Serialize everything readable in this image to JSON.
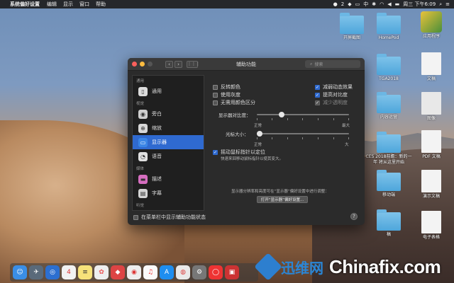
{
  "menubar": {
    "apple": "",
    "app": "系统偏好设置",
    "items": [
      "编辑",
      "显示",
      "窗口",
      "帮助"
    ],
    "status": {
      "badge": "2",
      "input": "中",
      "clock": "周三 下午6:09"
    }
  },
  "desktop": {
    "icons": [
      {
        "label": "开屏截图"
      },
      {
        "label": "HomePod"
      },
      {
        "label": "应用程序"
      },
      {
        "label": "TGA2018"
      },
      {
        "label": "文稿"
      },
      {
        "label": "内容运营"
      },
      {
        "label": "图像"
      },
      {
        "label": "CES 2018前瞻：新的一年 将从这里开始"
      },
      {
        "label": "PDF 文稿"
      },
      {
        "label": "移动端"
      },
      {
        "label": "演示文稿"
      },
      {
        "label": "稿"
      },
      {
        "label": "电子表格"
      }
    ]
  },
  "window": {
    "title": "辅助功能",
    "search_placeholder": "搜索",
    "sidebar": {
      "sections": {
        "general": "通用",
        "vision": "视觉",
        "media": "媒体",
        "hearing": "听觉"
      },
      "items": [
        {
          "label": "通用"
        },
        {
          "label": "旁白"
        },
        {
          "label": "缩放"
        },
        {
          "label": "显示器"
        },
        {
          "label": "语音"
        },
        {
          "label": "描述"
        },
        {
          "label": "字幕"
        }
      ]
    },
    "display": {
      "invert": "反转颜色",
      "grayscale": "使用灰度",
      "differentiate": "无需用颜色区分",
      "reduce_motion": "减弱动态效果",
      "increase_contrast": "提高对比度",
      "reduce_transparency": "减少透明度",
      "contrast_label": "显示器对比度：",
      "contrast_min": "正常",
      "contrast_max": "最大",
      "contrast_value": 0.25,
      "cursor_label": "光标大小：",
      "cursor_min": "正常",
      "cursor_max": "大",
      "cursor_value": 0.0,
      "shake_label": "摇动鼠标指针以定位",
      "shake_desc": "快速来回移动鼠标指针以使其变大。",
      "note": "显示器分辨率和亮度可在“显示器”偏好设置中进行调整：",
      "open_button": "打开“显示器”偏好设置..."
    },
    "bottom_checkbox": "在菜单栏中显示辅助功能状态",
    "help": "?"
  },
  "watermark": {
    "cn": "迅维网",
    "en": "Chinafix.com"
  }
}
